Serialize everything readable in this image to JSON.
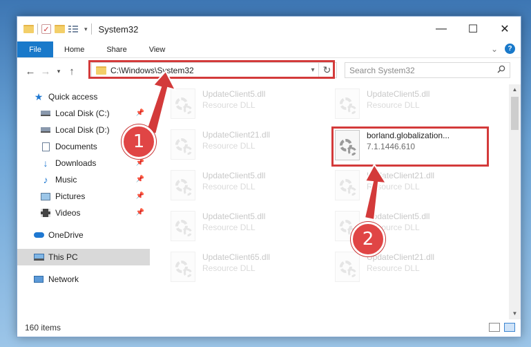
{
  "window": {
    "title": "System32",
    "controls": {
      "minimize": "—",
      "maximize": "☐",
      "close": "✕"
    }
  },
  "ribbon": {
    "tabs": [
      {
        "label": "File"
      },
      {
        "label": "Home"
      },
      {
        "label": "Share"
      },
      {
        "label": "View"
      }
    ],
    "expand_icon": "⌄",
    "help_label": "?"
  },
  "address_bar": {
    "path": "C:\\Windows\\System32",
    "search_placeholder": "Search System32"
  },
  "nav_pane": {
    "quick_access": "Quick access",
    "items": [
      {
        "label": "Local Disk (C:)",
        "icon": "drive-icon",
        "pinned": true
      },
      {
        "label": "Local Disk (D:)",
        "icon": "drive-icon",
        "pinned": true
      },
      {
        "label": "Documents",
        "icon": "documents-icon",
        "pinned": true
      },
      {
        "label": "Downloads",
        "icon": "downloads-icon",
        "pinned": true
      },
      {
        "label": "Music",
        "icon": "music-icon",
        "pinned": true
      },
      {
        "label": "Pictures",
        "icon": "pictures-icon",
        "pinned": true
      },
      {
        "label": "Videos",
        "icon": "videos-icon",
        "pinned": true
      }
    ],
    "onedrive": "OneDrive",
    "this_pc": "This PC",
    "network": "Network"
  },
  "files": [
    {
      "name": "UpdateClient5.dll",
      "type": "Resource DLL"
    },
    {
      "name": "UpdateClient5.dll",
      "type": "Resource DLL"
    },
    {
      "name": "UpdateClient21.dll",
      "type": "Resource DLL"
    },
    {
      "name": "borland.globalization...",
      "type": "7.1.1446.610"
    },
    {
      "name": "UpdateClient5.dll",
      "type": "Resource DLL"
    },
    {
      "name": "UpdateClient21.dll",
      "type": "Resource DLL"
    },
    {
      "name": "UpdateClient5.dll",
      "type": "Resource DLL"
    },
    {
      "name": "UpdateClient5.dll",
      "type": "Resource DLL"
    },
    {
      "name": "UpdateClient65.dll",
      "type": "Resource DLL"
    },
    {
      "name": "UpdateClient21.dll",
      "type": "Resource DLL"
    }
  ],
  "status": {
    "item_count": "160 items"
  },
  "annotations": {
    "badge1": "1",
    "badge2": "2",
    "color": "#d33a3a"
  }
}
